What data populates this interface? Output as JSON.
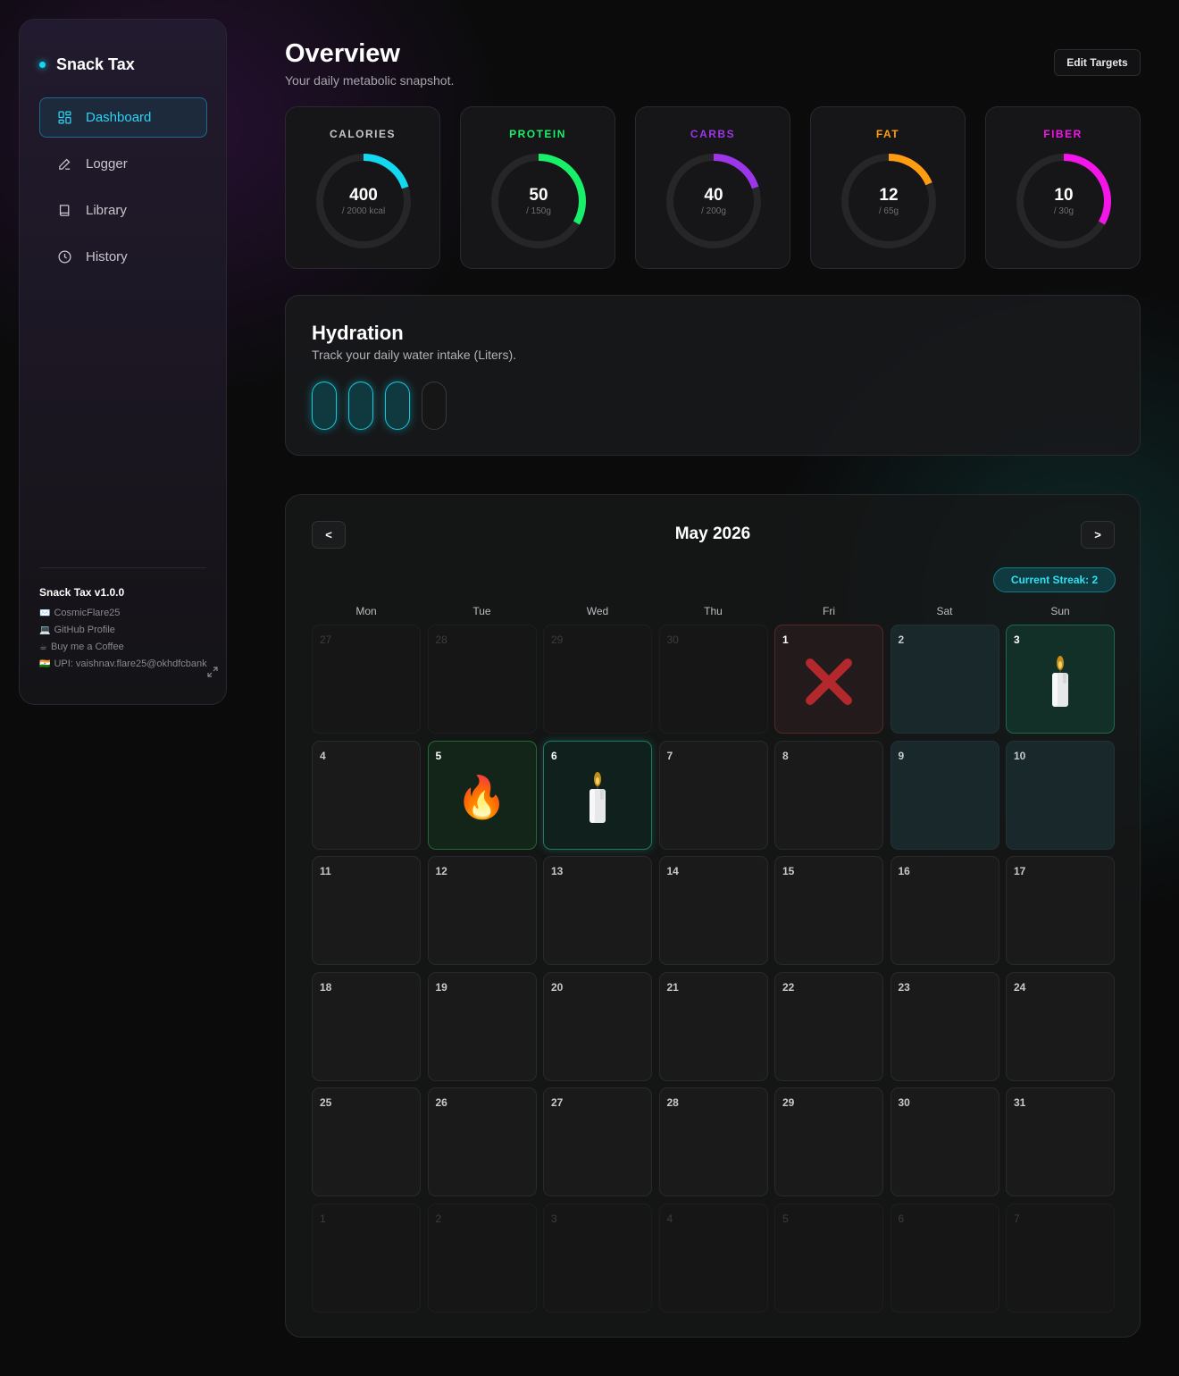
{
  "sidebar": {
    "brand": "Snack Tax",
    "nav": [
      {
        "label": "Dashboard",
        "icon": "dashboard-icon",
        "active": true
      },
      {
        "label": "Logger",
        "icon": "pencil-icon",
        "active": false
      },
      {
        "label": "Library",
        "icon": "book-icon",
        "active": false
      },
      {
        "label": "History",
        "icon": "clock-icon",
        "active": false
      }
    ],
    "version": "Snack Tax v1.0.0",
    "links": [
      {
        "icon": "✉️",
        "label": "CosmicFlare25"
      },
      {
        "icon": "💻",
        "label": "GitHub Profile"
      },
      {
        "icon": "☕",
        "label": "Buy me a Coffee"
      },
      {
        "icon": "🇮🇳",
        "label": "UPI: vaishnav.flare25@okhdfcbank"
      }
    ]
  },
  "header": {
    "title": "Overview",
    "subtitle": "Your daily metabolic snapshot.",
    "edit_button": "Edit Targets"
  },
  "macros": [
    {
      "label": "CALORIES",
      "value": "400",
      "target": "/ 2000 kcal",
      "fraction": 0.2,
      "color": "#12d8f0"
    },
    {
      "label": "PROTEIN",
      "value": "50",
      "target": "/ 150g",
      "fraction": 0.333,
      "color": "#19f06a"
    },
    {
      "label": "CARBS",
      "value": "40",
      "target": "/ 200g",
      "fraction": 0.2,
      "color": "#9d36e8"
    },
    {
      "label": "FAT",
      "value": "12",
      "target": "/ 65g",
      "fraction": 0.185,
      "color": "#ff9d12"
    },
    {
      "label": "FIBER",
      "value": "10",
      "target": "/ 30g",
      "fraction": 0.333,
      "color": "#f415e8"
    }
  ],
  "hydration": {
    "title": "Hydration",
    "subtitle": "Track your daily water intake (Liters).",
    "glasses_filled": 3,
    "glasses_total": 4
  },
  "calendar": {
    "prev_label": "<",
    "next_label": ">",
    "month_title": "May 2026",
    "streak_label": "Current Streak: 2",
    "weekdays": [
      "Mon",
      "Tue",
      "Wed",
      "Thu",
      "Fri",
      "Sat",
      "Sun"
    ],
    "weeks": [
      [
        {
          "n": "27",
          "s": "muted"
        },
        {
          "n": "28",
          "s": "muted"
        },
        {
          "n": "29",
          "s": "muted"
        },
        {
          "n": "30",
          "s": "muted"
        },
        {
          "n": "1",
          "s": "miss",
          "m": "✕"
        },
        {
          "n": "2",
          "s": "teal"
        },
        {
          "n": "3",
          "s": "streak-day",
          "m": "candle"
        }
      ],
      [
        {
          "n": "4",
          "s": ""
        },
        {
          "n": "5",
          "s": "fire-day",
          "m": "🔥"
        },
        {
          "n": "6",
          "s": "today",
          "m": "candle"
        },
        {
          "n": "7",
          "s": ""
        },
        {
          "n": "8",
          "s": ""
        },
        {
          "n": "9",
          "s": "teal"
        },
        {
          "n": "10",
          "s": "teal"
        }
      ],
      [
        {
          "n": "11",
          "s": ""
        },
        {
          "n": "12",
          "s": ""
        },
        {
          "n": "13",
          "s": ""
        },
        {
          "n": "14",
          "s": ""
        },
        {
          "n": "15",
          "s": ""
        },
        {
          "n": "16",
          "s": ""
        },
        {
          "n": "17",
          "s": ""
        }
      ],
      [
        {
          "n": "18",
          "s": ""
        },
        {
          "n": "19",
          "s": ""
        },
        {
          "n": "20",
          "s": ""
        },
        {
          "n": "21",
          "s": ""
        },
        {
          "n": "22",
          "s": ""
        },
        {
          "n": "23",
          "s": ""
        },
        {
          "n": "24",
          "s": ""
        }
      ],
      [
        {
          "n": "25",
          "s": ""
        },
        {
          "n": "26",
          "s": ""
        },
        {
          "n": "27",
          "s": ""
        },
        {
          "n": "28",
          "s": ""
        },
        {
          "n": "29",
          "s": ""
        },
        {
          "n": "30",
          "s": ""
        },
        {
          "n": "31",
          "s": ""
        }
      ],
      [
        {
          "n": "1",
          "s": "muted"
        },
        {
          "n": "2",
          "s": "muted"
        },
        {
          "n": "3",
          "s": "muted"
        },
        {
          "n": "4",
          "s": "muted"
        },
        {
          "n": "5",
          "s": "muted"
        },
        {
          "n": "6",
          "s": "muted"
        },
        {
          "n": "7",
          "s": "muted"
        }
      ]
    ]
  }
}
